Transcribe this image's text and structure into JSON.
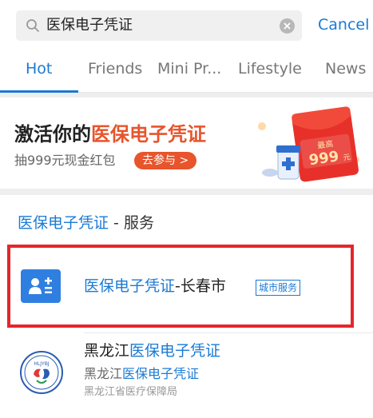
{
  "search": {
    "query": "医保电子凭证",
    "cancel_label": "Cancel"
  },
  "tabs": [
    {
      "label": "Hot",
      "active": true
    },
    {
      "label": "Friends",
      "active": false
    },
    {
      "label": "Mini Pr...",
      "active": false
    },
    {
      "label": "Lifestyle",
      "active": false
    },
    {
      "label": "News",
      "active": false
    }
  ],
  "banner": {
    "title_prefix": "激活你的",
    "title_highlight": "医保电子凭证",
    "subtitle": "抽999元现金红包",
    "button_label": "去参与 >",
    "packet_top": "最高",
    "packet_amount": "999",
    "packet_unit": "元",
    "accent_color": "#e8542b"
  },
  "section": {
    "title_highlight": "医保电子凭证",
    "title_suffix": " - 服务"
  },
  "service": {
    "name_highlight": "医保电子凭证",
    "name_suffix": "-长春市",
    "tag": "城市服务",
    "icon": "contact-card-icon"
  },
  "result": {
    "title_prefix": "黑龙江",
    "title_highlight": "医保电子凭证",
    "subtitle_prefix": "黑龙江",
    "subtitle_highlight": "医保电子凭证",
    "org": "黑龙江省医疗保障局",
    "logo_text": "HLJYBJ",
    "icon": "provincial-seal-logo"
  },
  "colors": {
    "accent_blue": "#1a7ad4",
    "highlight_frame": "#e6262c"
  }
}
